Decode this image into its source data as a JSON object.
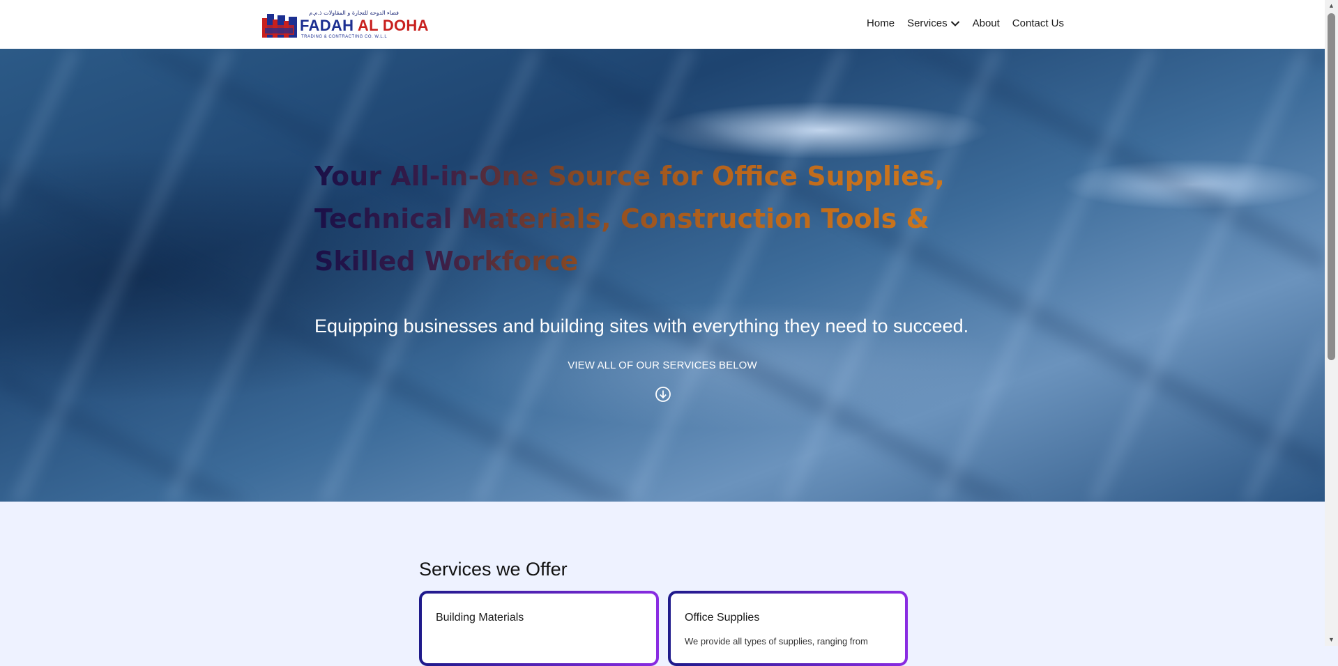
{
  "logo": {
    "arabic_text": "فضاء الدوحة للتجارة و المقاولات ذ.م.م",
    "name_primary": "FADAH ",
    "name_accent": "AL DOHA",
    "subtitle": "TRADING & CONTRACTING CO. W.L.L",
    "colors": {
      "blue": "#1c2f91",
      "red": "#c8201e"
    }
  },
  "nav": {
    "items": [
      {
        "label": "Home"
      },
      {
        "label": "Services",
        "icon": "chevron-down-icon"
      },
      {
        "label": "About"
      },
      {
        "label": "Contact Us"
      }
    ]
  },
  "hero": {
    "title": "Your All-in-One Source for Office Supplies, Technical Materials, Construction Tools & Skilled Workforce",
    "subtitle": "Equipping businesses and building sites with everything they need to succeed.",
    "cta": "VIEW ALL OF OUR SERVICES BELOW",
    "cta_icon": "arrow-down-circle-icon",
    "title_gradient": [
      "#1a1048",
      "#8a4a22",
      "#d07a1e"
    ]
  },
  "services": {
    "title": "Services we Offer",
    "cards": [
      {
        "title": "Building Materials",
        "text": ""
      },
      {
        "title": "Office Supplies",
        "text": "We provide all types of supplies, ranging from"
      }
    ],
    "card_border_gradient": [
      "#1e1a8a",
      "#8a2be2"
    ]
  },
  "colors": {
    "header_bg": "#ffffff",
    "section_bg": "#eef2ff"
  }
}
